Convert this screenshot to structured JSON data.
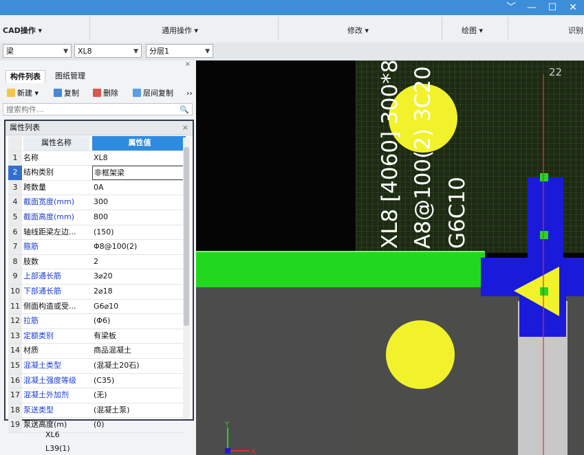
{
  "ribbon": {
    "groups": [
      "CAD操作 ▾",
      "通用操作 ▾",
      "修改 ▾",
      "绘图 ▾",
      "识别"
    ]
  },
  "window_controls": [
    "﹀",
    "—",
    "☐",
    "✕"
  ],
  "selectors": {
    "type": "梁",
    "component": "XL8",
    "layer": "分层1"
  },
  "left_panel": {
    "tabs": [
      "构件列表",
      "图纸管理"
    ],
    "buttons": [
      "新建",
      "复制",
      "删除",
      "层间复制"
    ],
    "search_placeholder": "搜索构件..."
  },
  "props": {
    "title": "属性列表",
    "col_name": "属性名称",
    "col_value": "属性值",
    "rows": [
      {
        "num": "1",
        "name": "名称",
        "value": "XL8"
      },
      {
        "num": "2",
        "name": "结构类别",
        "value": "非框架梁"
      },
      {
        "num": "3",
        "name": "跨数量",
        "value": "0A"
      },
      {
        "num": "4",
        "name": "截面宽度(mm)",
        "value": "300"
      },
      {
        "num": "5",
        "name": "截面高度(mm)",
        "value": "800"
      },
      {
        "num": "6",
        "name": "轴线距梁左边...",
        "value": "(150)"
      },
      {
        "num": "7",
        "name": "箍筋",
        "value": "Φ8@100(2)"
      },
      {
        "num": "8",
        "name": "肢数",
        "value": "2"
      },
      {
        "num": "9",
        "name": "上部通长筋",
        "value": "3⌀20"
      },
      {
        "num": "10",
        "name": "下部通长筋",
        "value": "2⌀18"
      },
      {
        "num": "11",
        "name": "侧面构造或受...",
        "value": "G6⌀10"
      },
      {
        "num": "12",
        "name": "拉筋",
        "value": "(Φ6)"
      },
      {
        "num": "13",
        "name": "定额类别",
        "value": "有梁板"
      },
      {
        "num": "14",
        "name": "材质",
        "value": "商品混凝土"
      },
      {
        "num": "15",
        "name": "混凝土类型",
        "value": "(混凝土20石)"
      },
      {
        "num": "16",
        "name": "混凝土强度等级",
        "value": "(C35)"
      },
      {
        "num": "17",
        "name": "混凝土外加剂",
        "value": "(无)"
      },
      {
        "num": "18",
        "name": "泵送类型",
        "value": "(混凝土泵)"
      },
      {
        "num": "19",
        "name": "泵送高度(m)",
        "value": "(0)"
      }
    ]
  },
  "tree": [
    "XL6",
    "L39(1)"
  ],
  "canvas": {
    "axis_label": "22",
    "annotations": [
      "XL8 [4060] 300*8",
      "A8@100(2) 3C20",
      "G6C10"
    ],
    "axis_y": "Y",
    "axis_x": "X"
  },
  "colors": {
    "titlebar": "#3c8ed8",
    "beam_green": "#22d81f",
    "column_blue": "#1a1adb",
    "rebar_yellow": "#f2f22c",
    "axis_red": "#e03030"
  }
}
